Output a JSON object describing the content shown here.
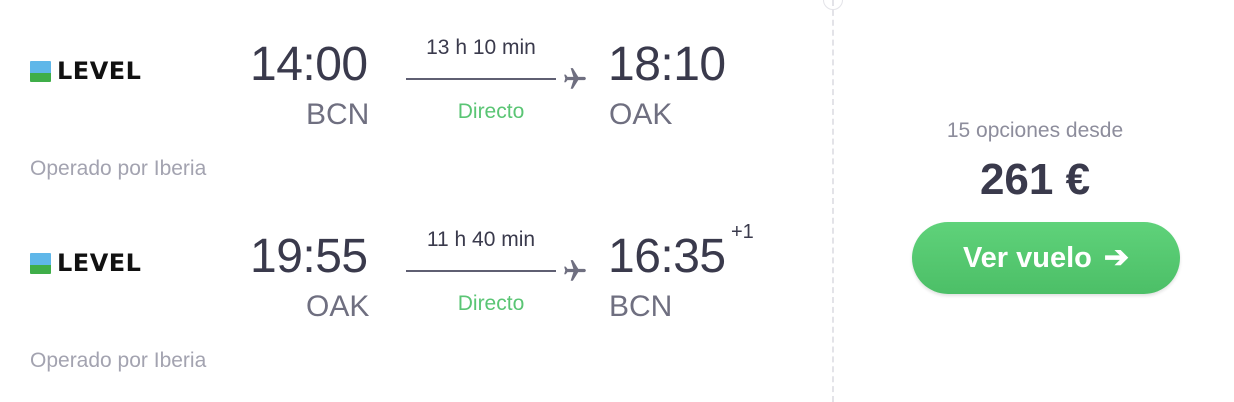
{
  "flights": [
    {
      "airline": "LEVEL",
      "departure_time": "14:00",
      "departure_code": "BCN",
      "duration": "13 h 10 min",
      "stops": "Directo",
      "arrival_time": "18:10",
      "arrival_code": "OAK",
      "day_offset": "",
      "operated_by": "Operado por Iberia"
    },
    {
      "airline": "LEVEL",
      "departure_time": "19:55",
      "departure_code": "OAK",
      "duration": "11 h 40 min",
      "stops": "Directo",
      "arrival_time": "16:35",
      "arrival_code": "BCN",
      "day_offset": "+1",
      "operated_by": "Operado por Iberia"
    }
  ],
  "price_box": {
    "options_label": "15 opciones desde",
    "price": "261 €",
    "cta_label": "Ver vuelo",
    "cta_icon": "arrow-right-icon"
  },
  "colors": {
    "accent_green": "#56c873",
    "direct_green": "#5ac574",
    "text_dark": "#3a3a4c",
    "text_muted": "#a3a3b0"
  }
}
